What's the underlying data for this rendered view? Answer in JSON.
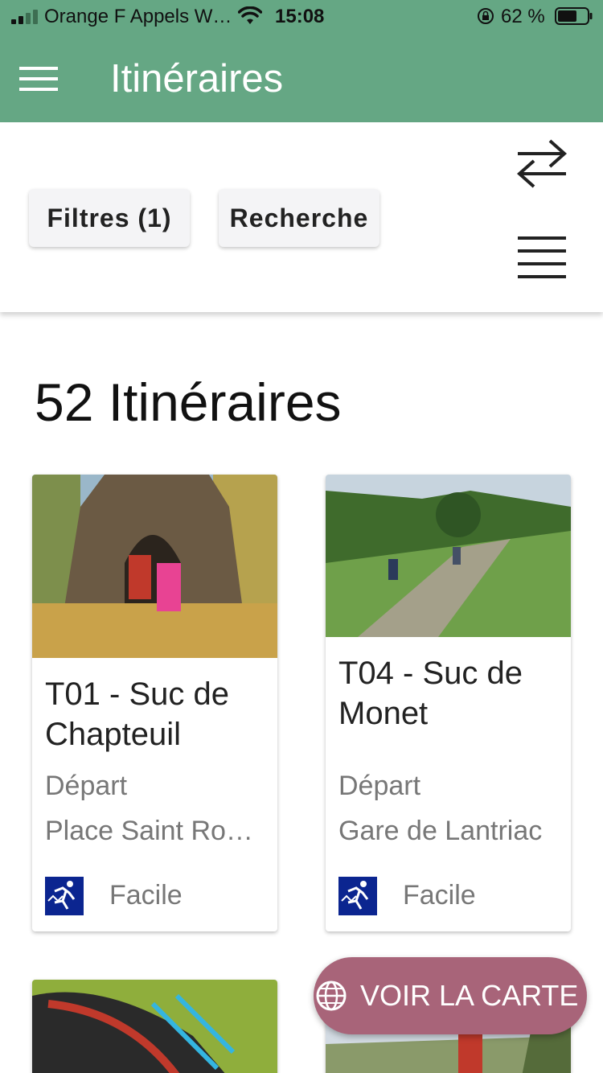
{
  "status_bar": {
    "carrier": "Orange F Appels W…",
    "time": "15:08",
    "battery_percent": "62 %"
  },
  "app_bar": {
    "title": "Itinéraires"
  },
  "toolbar": {
    "filters_label": "Filtres (1)",
    "search_label": "Recherche"
  },
  "results": {
    "count_label": "52 Itinéraires"
  },
  "cards": [
    {
      "name": "T01 - Suc de Chapteuil",
      "start_label": "Départ",
      "start_place": "Place Saint Romain",
      "difficulty": "Facile",
      "photo_colors": [
        "#6b5a44",
        "#c9a24a"
      ]
    },
    {
      "name": "T04 - Suc de Monet",
      "start_label": "Départ",
      "start_place": "Gare de Lantriac",
      "difficulty": "Facile",
      "photo_colors": [
        "#4d8a3a",
        "#a4c77a"
      ]
    }
  ],
  "fab": {
    "label": "VOIR LA CARTE"
  },
  "colors": {
    "primary": "#65a784",
    "fab": "#a86479",
    "difficulty_icon": "#0b2590"
  }
}
